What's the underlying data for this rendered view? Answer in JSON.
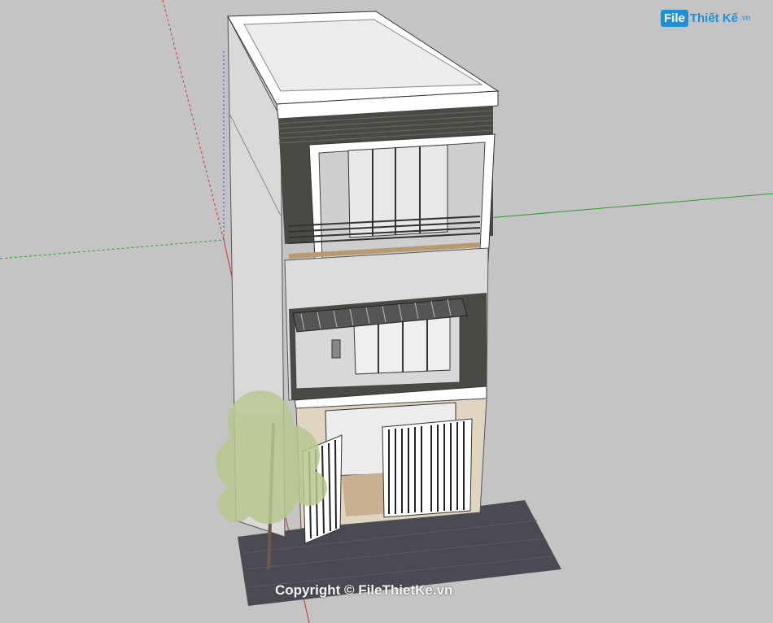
{
  "watermark": {
    "logo_badge": "File",
    "logo_text": "Thiết Kế",
    "logo_tld": ".vn",
    "copyright": "Copyright © FileThietKe.vn"
  },
  "scene": {
    "background": "#c4c4c4",
    "axis_colors": {
      "red": "#d03030",
      "green": "#2a9a2a",
      "blue": "#3040c0"
    },
    "wall_color": "#e6e6e6",
    "slat_color": "#4a4a44",
    "paving_color": "#4a4b52"
  }
}
